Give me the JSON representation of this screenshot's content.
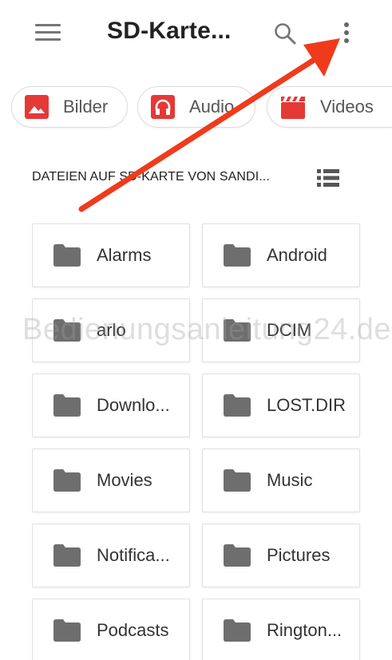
{
  "appbar": {
    "title": "SD-Karte...",
    "menu_icon": "menu-icon",
    "search_icon": "search-icon",
    "more_icon": "more-vert-icon"
  },
  "chips": [
    {
      "label": "Bilder",
      "icon": "image-icon",
      "color": "#e53935"
    },
    {
      "label": "Audio",
      "icon": "headphones-icon",
      "color": "#e53935"
    },
    {
      "label": "Videos",
      "icon": "clapperboard-icon",
      "color": "#e53935"
    }
  ],
  "section": {
    "title": "DATEIEN AUF SD-KARTE VON SANDI...",
    "view_icon": "list-view-icon"
  },
  "folders": [
    {
      "label": "Alarms"
    },
    {
      "label": "Android"
    },
    {
      "label": "arlo"
    },
    {
      "label": "DCIM"
    },
    {
      "label": "Downlo..."
    },
    {
      "label": "LOST.DIR"
    },
    {
      "label": "Movies"
    },
    {
      "label": "Music"
    },
    {
      "label": "Notifica..."
    },
    {
      "label": "Pictures"
    },
    {
      "label": "Podcasts"
    },
    {
      "label": "Rington..."
    }
  ],
  "watermark": "Bedienungsanleitung24.de",
  "colors": {
    "folder": "#6e6e6e",
    "accent": "#e53935",
    "arrow": "#f03a1c"
  }
}
